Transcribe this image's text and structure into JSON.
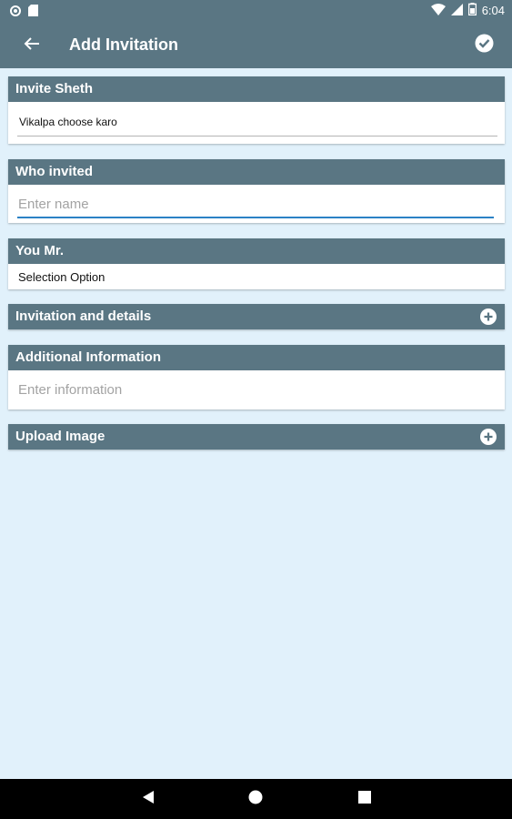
{
  "status": {
    "time": "6:04"
  },
  "app": {
    "title": "Add Invitation"
  },
  "sections": {
    "invite_sheth": {
      "label": "Invite Sheth",
      "value": "Vikalpa choose karo"
    },
    "who_invited": {
      "label": "Who invited",
      "placeholder": "Enter name"
    },
    "you_mr": {
      "label": "You Mr.",
      "value": "Selection Option"
    },
    "invitation_details": {
      "label": "Invitation and details"
    },
    "additional_info": {
      "label": "Additional Information",
      "placeholder": "Enter information"
    },
    "upload_image": {
      "label": "Upload Image"
    }
  },
  "colors": {
    "primary": "#5a7683",
    "background": "#e1f1fb",
    "accent": "#2b82c5"
  },
  "icons": [
    "back-arrow-icon",
    "check-icon",
    "plus-icon",
    "nav-back-icon",
    "nav-home-icon",
    "nav-recents-icon"
  ]
}
